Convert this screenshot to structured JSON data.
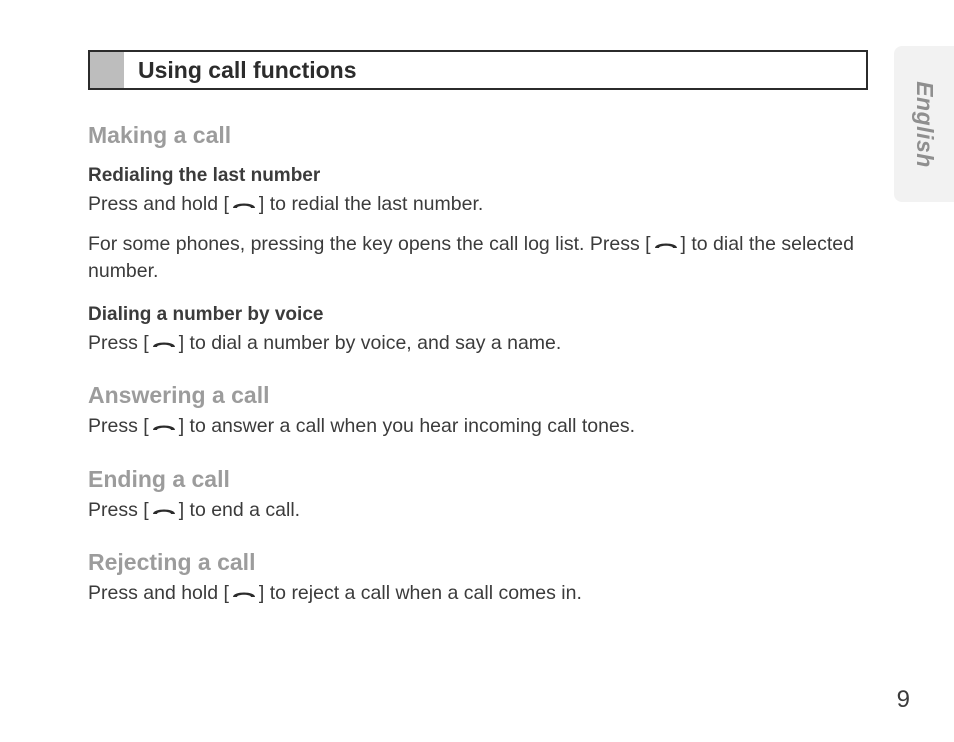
{
  "title": "Using call functions",
  "sideTab": "English",
  "pageNumber": "9",
  "sections": {
    "making": {
      "heading": "Making a call",
      "redialSub": "Redialing the last number",
      "redialText1a": "Press and hold [",
      "redialText1b": "] to redial the last number.",
      "redialText2a": "For some phones, pressing the key opens the call log list. Press [",
      "redialText2b": "] to dial the selected number.",
      "voiceSub": "Dialing a number by voice",
      "voiceTextA": "Press [",
      "voiceTextB": "] to dial a number by voice, and say a name."
    },
    "answering": {
      "heading": "Answering a call",
      "textA": "Press [",
      "textB": "] to answer a call when you hear incoming call tones."
    },
    "ending": {
      "heading": "Ending a call",
      "textA": "Press [",
      "textB": "] to end a call."
    },
    "rejecting": {
      "heading": "Rejecting a call",
      "textA": "Press and hold [",
      "textB": "] to reject a call when a call comes in."
    }
  }
}
